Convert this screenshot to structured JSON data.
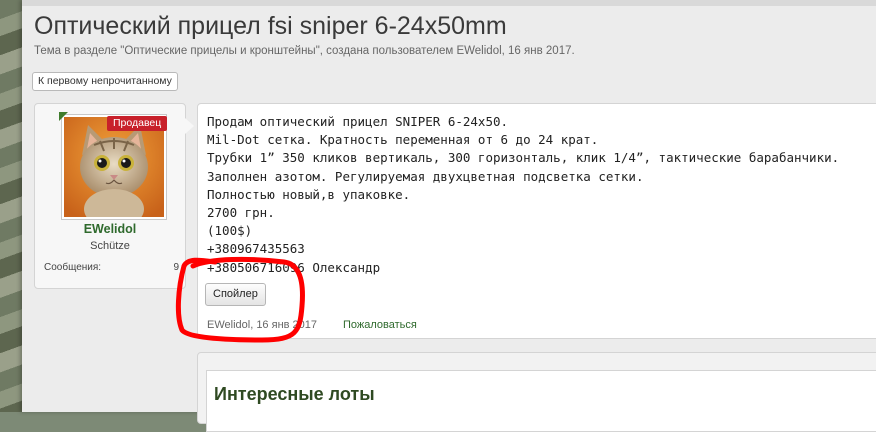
{
  "thread": {
    "title": "Оптический прицел fsi sniper 6-24x50mm",
    "subtitle": "Тема в разделе \"Оптические прицелы и кронштейны\", создана пользователем EWelidol, 16 янв 2017.",
    "unread_button": "К первому непрочитанному"
  },
  "user": {
    "badge": "Продавец",
    "name": "EWelidol",
    "title": "Schütze",
    "messages_label": "Сообщения:",
    "messages_value": "9"
  },
  "post": {
    "lines": [
      "Продам оптический прицел SNIPER 6-24х50.",
      "Mil-Dot сетка. Кратность переменная от 6 до 24 крат.",
      "Трубки 1” 350 кликов вертикаль, 300 горизонталь, клик 1/4”, тактические барабанчики.",
      "Заполнен азотом. Регулируемая двухцветная подсветка сетки.",
      "Полностью новый,в упаковке.",
      "2700 грн.",
      "(100$)",
      "+380967435563",
      "+380506716096 Олександр"
    ],
    "spoiler_button": "Спойлер",
    "meta": "EWelidol, 16 янв 2017",
    "report_link": "Пожаловаться"
  },
  "lots": {
    "title": "Интересные лоты"
  },
  "colors": {
    "accent_green": "#2f6a2d",
    "badge_red": "#c8202a",
    "annotation_red": "#ff0000"
  }
}
